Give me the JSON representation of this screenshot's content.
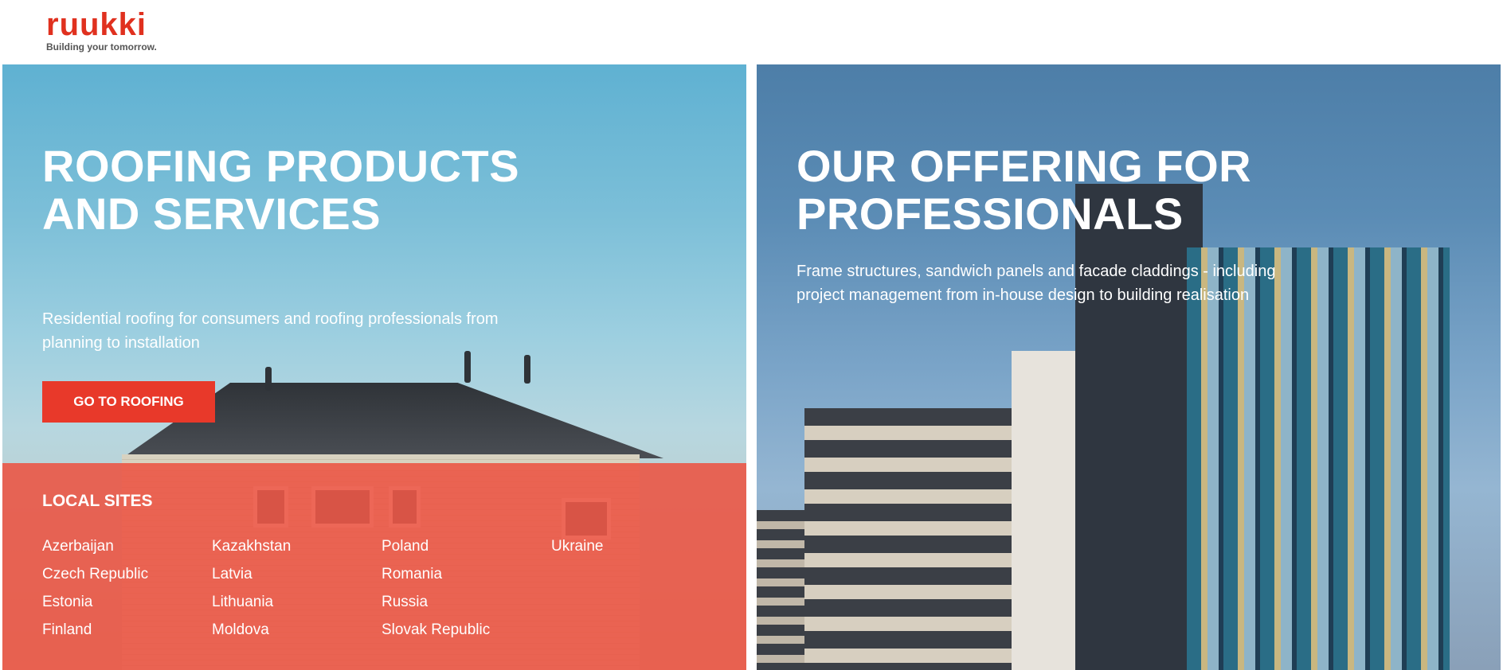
{
  "header": {
    "logo_word": "ruukki",
    "logo_tagline": "Building your tomorrow.",
    "brand_color": "#e0311f"
  },
  "roofing": {
    "title": "ROOFING PRODUCTS AND SERVICES",
    "description": "Residential roofing for consumers and roofing professionals from planning to installation",
    "button_label": "GO TO ROOFING",
    "button_color": "#e8392a",
    "local_sites": {
      "title": "LOCAL SITES",
      "overlay_color": "#ec5342",
      "columns": [
        [
          "Azerbaijan",
          "Czech Republic",
          "Estonia",
          "Finland"
        ],
        [
          "Kazakhstan",
          "Latvia",
          "Lithuania",
          "Moldova"
        ],
        [
          "Poland",
          "Romania",
          "Russia",
          "Slovak Republic"
        ],
        [
          "Ukraine"
        ]
      ]
    }
  },
  "professionals": {
    "title": "OUR OFFERING FOR PROFESSIONALS",
    "description": "Frame structures, sandwich panels and facade claddings - including project management from in-house design to building realisation"
  }
}
